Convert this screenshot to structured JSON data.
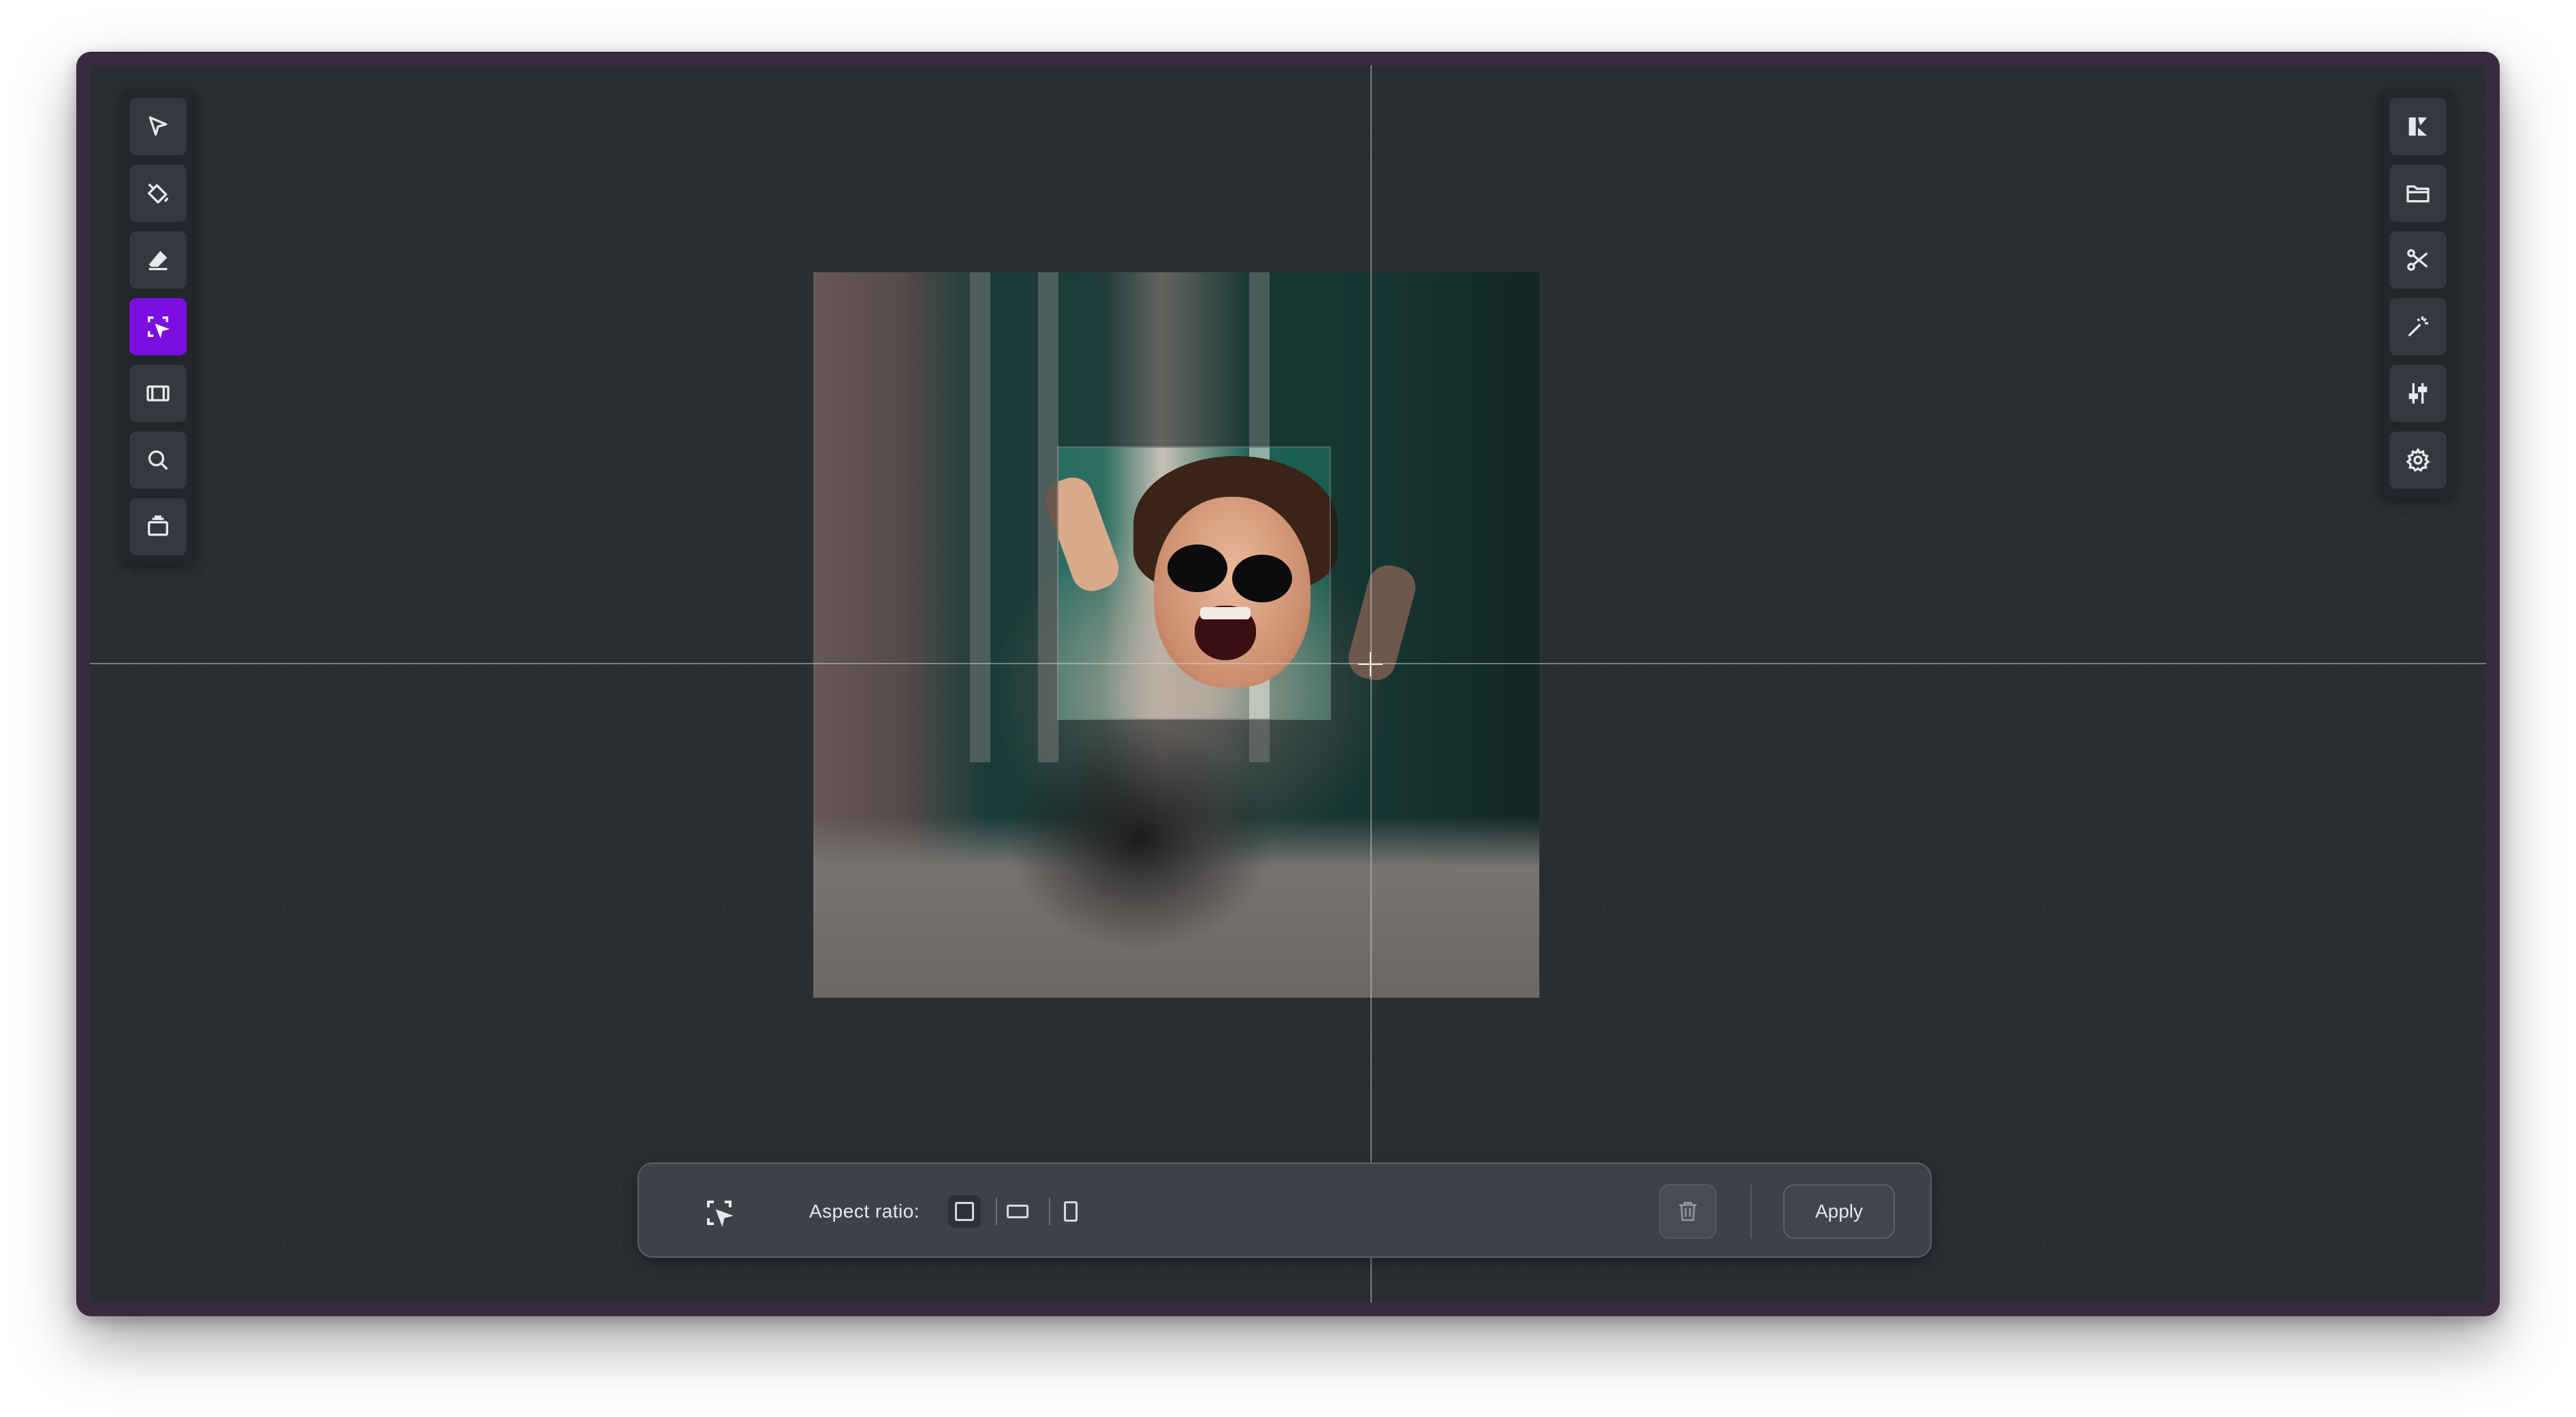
{
  "left_toolbar": {
    "tools": [
      {
        "name": "select-tool",
        "icon": "pointer-arrow-icon"
      },
      {
        "name": "fill-tool",
        "icon": "paint-bucket-icon"
      },
      {
        "name": "eraser-tool",
        "icon": "eraser-icon"
      },
      {
        "name": "crop-select-tool",
        "icon": "crop-cursor-icon",
        "active": true
      },
      {
        "name": "frame-tool",
        "icon": "filmstrip-icon"
      },
      {
        "name": "zoom-tool",
        "icon": "magnifier-icon"
      },
      {
        "name": "layers-tool",
        "icon": "stack-icon"
      }
    ]
  },
  "right_toolbar": {
    "tools": [
      {
        "name": "logo-button",
        "icon": "brand-logo-icon"
      },
      {
        "name": "open-folder-button",
        "icon": "folder-icon"
      },
      {
        "name": "transform-button",
        "icon": "scissors-icon"
      },
      {
        "name": "magic-button",
        "icon": "magic-wand-icon"
      },
      {
        "name": "adjust-button",
        "icon": "sliders-icon"
      },
      {
        "name": "settings-button",
        "icon": "gear-icon"
      }
    ]
  },
  "crop_panel": {
    "aspect_ratio_label": "Aspect ratio:",
    "ratio_options": [
      "square",
      "landscape",
      "portrait"
    ],
    "selected_ratio": "square",
    "apply_label": "Apply"
  },
  "colors": {
    "accent": "#7a0fe0",
    "canvas_bg": "#2a2e33",
    "toolbar_bg": "#22252a"
  }
}
